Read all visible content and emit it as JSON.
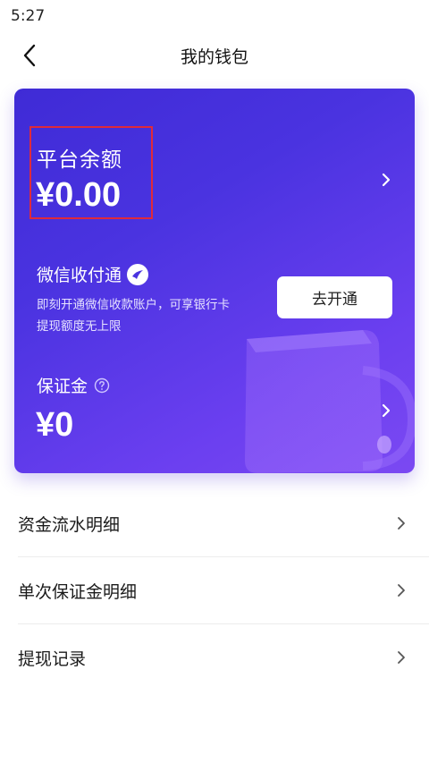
{
  "status_bar": {
    "time": "5:27"
  },
  "header": {
    "title": "我的钱包"
  },
  "wallet": {
    "balance_label": "平台余额",
    "balance_amount": "¥0.00",
    "wechat": {
      "title": "微信收付通",
      "desc_line1": "即刻开通微信收款账户，可享银行卡",
      "desc_line2": "提现额度无上限",
      "open_button": "去开通"
    },
    "deposit_label": "保证金",
    "deposit_amount": "¥0"
  },
  "menu": [
    {
      "label": "资金流水明细"
    },
    {
      "label": "单次保证金明细"
    },
    {
      "label": "提现记录"
    }
  ],
  "colors": {
    "card_gradient_start": "#3f2bd6",
    "card_gradient_end": "#7b49f2",
    "highlight_border": "#e02a3a"
  }
}
